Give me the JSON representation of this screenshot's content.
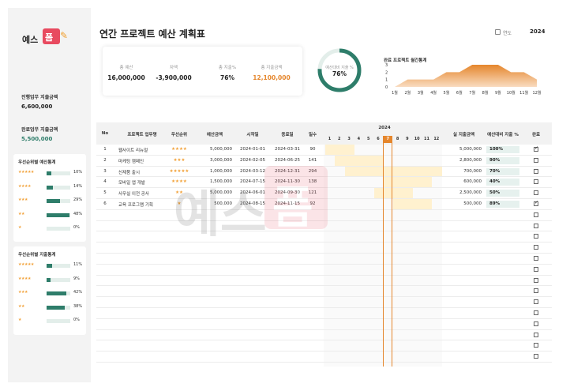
{
  "logo": {
    "text": "예스",
    "box_text": "폼"
  },
  "header": {
    "title": "연간 프로젝트 예산 계획표",
    "year_label": "연도",
    "year_value": "2024"
  },
  "sidebar": {
    "ongoing_label": "진행업무 지출금액",
    "ongoing_value": "6,600,000",
    "done_label": "완료업무 지출금액",
    "done_value": "5,500,000",
    "budget_stats": {
      "title": "우선순위별 예산통계",
      "rows": [
        {
          "stars": "★★★★★",
          "pct": "10%",
          "value": 0.1
        },
        {
          "stars": "★★★★",
          "pct": "14%",
          "value": 0.14
        },
        {
          "stars": "★★★",
          "pct": "29%",
          "value": 0.29
        },
        {
          "stars": "★★",
          "pct": "48%",
          "value": 0.48
        },
        {
          "stars": "★",
          "pct": "0%",
          "value": 0.0
        }
      ]
    },
    "spend_stats": {
      "title": "우선순위별 지출통계",
      "rows": [
        {
          "stars": "★★★★★",
          "pct": "11%",
          "value": 0.11
        },
        {
          "stars": "★★★★",
          "pct": "9%",
          "value": 0.09
        },
        {
          "stars": "★★★",
          "pct": "42%",
          "value": 0.42
        },
        {
          "stars": "★★",
          "pct": "38%",
          "value": 0.38
        },
        {
          "stars": "★",
          "pct": "0%",
          "value": 0.0
        }
      ]
    }
  },
  "kpis": [
    {
      "label": "총 예산",
      "value": "16,000,000"
    },
    {
      "label": "차액",
      "value": "-3,900,000"
    },
    {
      "label": "총 지출%",
      "value": "76%"
    },
    {
      "label": "총 지출금액",
      "value": "12,100,000"
    }
  ],
  "donut": {
    "label": "예산대비 지출 %",
    "value": "76%",
    "fraction": 0.76
  },
  "chart_data": {
    "type": "area",
    "title": "완료 프로젝트 월간통계",
    "categories": [
      "1월",
      "2월",
      "3월",
      "4월",
      "5월",
      "6월",
      "7월",
      "8월",
      "9월",
      "10월",
      "11월",
      "12월"
    ],
    "values": [
      0,
      1,
      1,
      1,
      2,
      2,
      3,
      3,
      3,
      2,
      2,
      1
    ],
    "ylim": [
      0,
      3
    ],
    "yticks": [
      "0",
      "1",
      "2",
      "3"
    ]
  },
  "table": {
    "headers": {
      "no": "No",
      "name": "프로젝트 업무명",
      "priority": "우선순위",
      "budget": "예산금액",
      "start": "시작일",
      "end": "종료일",
      "days": "일수",
      "year": "2024",
      "spent": "실 지출금액",
      "ratio": "예산대비 지출 %",
      "done": "완료"
    },
    "months": [
      "1",
      "2",
      "3",
      "4",
      "5",
      "6",
      "7",
      "8",
      "9",
      "10",
      "11",
      "12"
    ],
    "current_month": 7,
    "rows": [
      {
        "no": "1",
        "name": "웹사이트 리뉴얼",
        "priority": "★★★★",
        "budget": "5,000,000",
        "start": "2024-01-01",
        "end": "2024-03-31",
        "days": "90",
        "spent": "5,000,000",
        "ratio": "100%",
        "done": true,
        "start_m": 1,
        "end_m": 3
      },
      {
        "no": "2",
        "name": "마케팅 캠페인",
        "priority": "★★★",
        "budget": "3,000,000",
        "start": "2024-02-05",
        "end": "2024-06-25",
        "days": "141",
        "spent": "2,800,000",
        "ratio": "90%",
        "done": false,
        "start_m": 2,
        "end_m": 6
      },
      {
        "no": "3",
        "name": "신제품 출시",
        "priority": "★★★★★",
        "budget": "1,000,000",
        "start": "2024-03-12",
        "end": "2024-12-31",
        "days": "294",
        "spent": "700,000",
        "ratio": "70%",
        "done": false,
        "start_m": 3,
        "end_m": 12
      },
      {
        "no": "4",
        "name": "모바일 앱 개발",
        "priority": "★★★★",
        "budget": "1,500,000",
        "start": "2024-07-15",
        "end": "2024-11-30",
        "days": "138",
        "spent": "600,000",
        "ratio": "40%",
        "done": false,
        "start_m": 7,
        "end_m": 11
      },
      {
        "no": "5",
        "name": "사무실 이전 공사",
        "priority": "★★",
        "budget": "5,000,000",
        "start": "2024-06-01",
        "end": "2024-09-30",
        "days": "121",
        "spent": "2,500,000",
        "ratio": "50%",
        "done": false,
        "start_m": 6,
        "end_m": 9
      },
      {
        "no": "6",
        "name": "교육 프로그램 기획",
        "priority": "★",
        "budget": "500,000",
        "start": "2024-08-15",
        "end": "2024-11-15",
        "days": "92",
        "spent": "500,000",
        "ratio": "89%",
        "done": true,
        "start_m": 8,
        "end_m": 11
      }
    ],
    "empty_rows": 14
  },
  "colors": {
    "accent": "#e5862c",
    "teal": "#2e7d6a",
    "star": "#f2a23a",
    "brand": "#e84a5f"
  }
}
